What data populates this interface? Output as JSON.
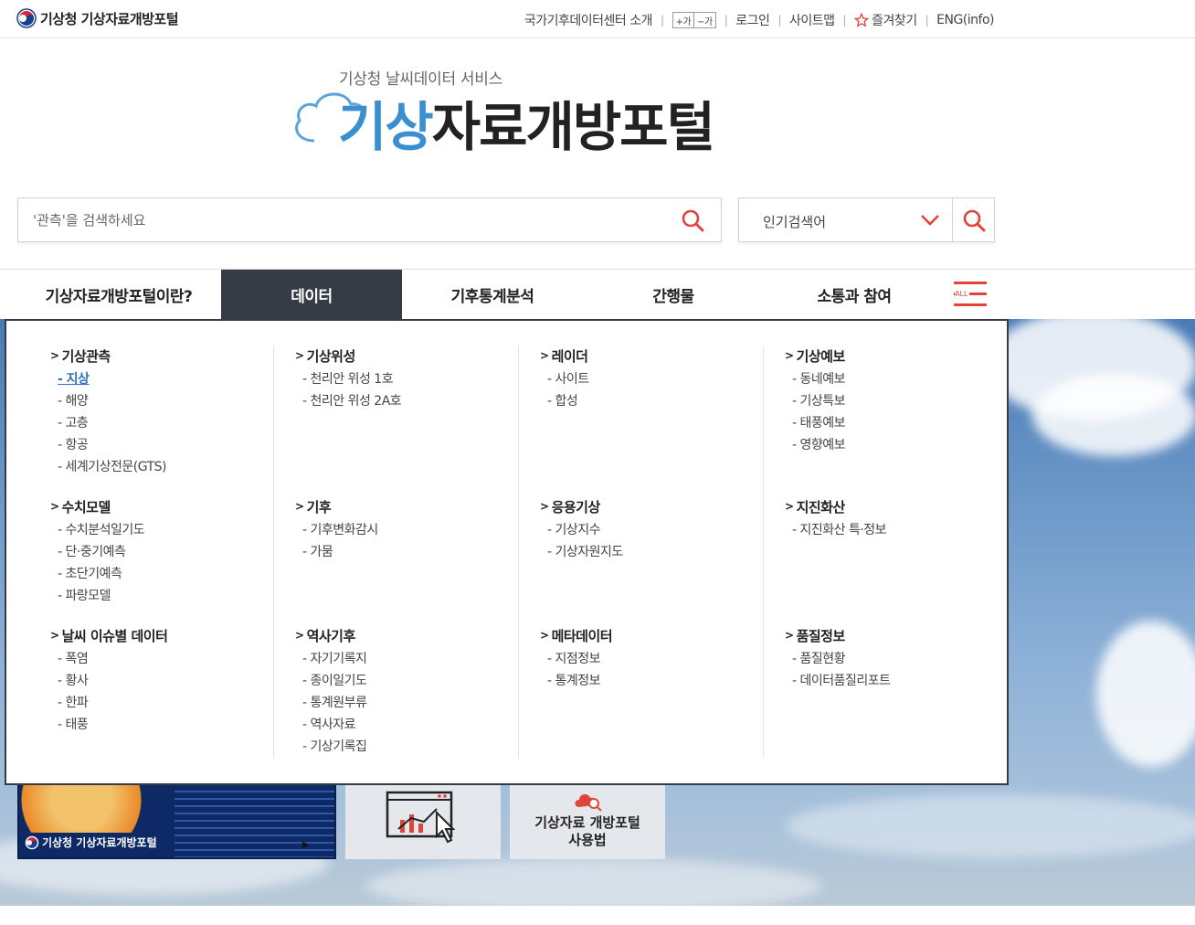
{
  "brand": {
    "name": "기상청 기상자료개방포털"
  },
  "util_links": {
    "center_intro": "국가기후데이터센터 소개",
    "font_plus": "+가",
    "font_minus": "−가",
    "login": "로그인",
    "sitemap": "사이트맵",
    "favorites": "즐겨찾기",
    "english": "ENG(info)"
  },
  "header": {
    "subtitle": "기상청 날씨데이터 서비스",
    "title_blue": "기상",
    "title_dark": "자료개방포털"
  },
  "search": {
    "placeholder": "'관측'을 검색하세요"
  },
  "popular": {
    "label": "인기검색어"
  },
  "nav": {
    "items": [
      "기상자료개방포털이란?",
      "데이터",
      "기후통계분석",
      "간행물",
      "소통과 참여"
    ],
    "active_index": 1,
    "all_label": "ALL"
  },
  "mega_menu": {
    "columns": [
      {
        "groups": [
          {
            "title": "기상관측",
            "items": [
              "지상",
              "해양",
              "고층",
              "항공",
              "세계기상전문(GTS)"
            ]
          },
          {
            "title": "수치모델",
            "items": [
              "수치분석일기도",
              "단·중기예측",
              "초단기예측",
              "파랑모델"
            ]
          },
          {
            "title": "날씨 이슈별 데이터",
            "items": [
              "폭염",
              "황사",
              "한파",
              "태풍"
            ]
          }
        ]
      },
      {
        "groups": [
          {
            "title": "기상위성",
            "items": [
              "천리안 위성 1호",
              "천리안 위성 2A호"
            ]
          },
          {
            "title": "기후",
            "items": [
              "기후변화감시",
              "가뭄"
            ]
          },
          {
            "title": "역사기후",
            "items": [
              "자기기록지",
              "종이일기도",
              "통계원부류",
              "역사자료",
              "기상기록집"
            ]
          }
        ]
      },
      {
        "groups": [
          {
            "title": "레이더",
            "items": [
              "사이트",
              "합성"
            ]
          },
          {
            "title": "응용기상",
            "items": [
              "기상지수",
              "기상자원지도"
            ]
          },
          {
            "title": "메타데이터",
            "items": [
              "지점정보",
              "통계정보"
            ]
          }
        ]
      },
      {
        "groups": [
          {
            "title": "기상예보",
            "items": [
              "동네예보",
              "기상특보",
              "태풍예보",
              "영향예보"
            ]
          },
          {
            "title": "지진화산",
            "items": [
              "지진화산 특·정보"
            ]
          },
          {
            "title": "품질정보",
            "items": [
              "품질현황",
              "데이터품질리포트"
            ]
          }
        ]
      }
    ],
    "selected_item": "지상"
  },
  "cards": {
    "video_logo": "기상청 기상자료개방포털",
    "guide_line1": "기상자료 개방포털",
    "guide_line2": "사용법"
  },
  "colors": {
    "accent_red": "#e0453c",
    "nav_active": "#353c45",
    "logo_blue": "#3b8fd0"
  }
}
